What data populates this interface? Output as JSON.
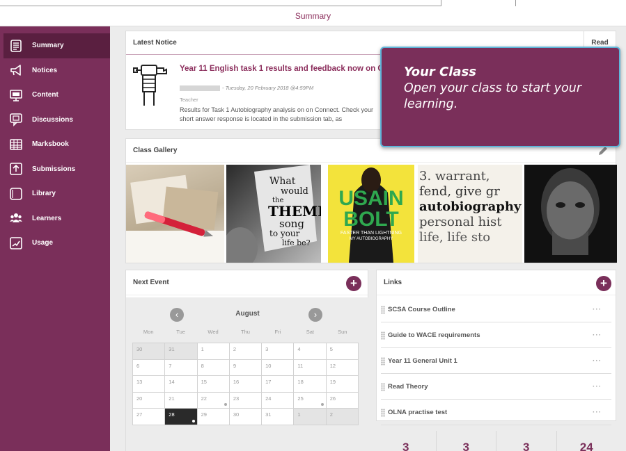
{
  "header": {
    "title": "Summary"
  },
  "sidebar": {
    "items": [
      {
        "label": "Summary",
        "icon": "summary-icon"
      },
      {
        "label": "Notices",
        "icon": "megaphone-icon"
      },
      {
        "label": "Content",
        "icon": "presentation-icon"
      },
      {
        "label": "Discussions",
        "icon": "chat-icon"
      },
      {
        "label": "Marksbook",
        "icon": "grid-icon"
      },
      {
        "label": "Submissions",
        "icon": "upload-icon"
      },
      {
        "label": "Library",
        "icon": "folder-icon"
      },
      {
        "label": "Learners",
        "icon": "people-icon"
      },
      {
        "label": "Usage",
        "icon": "chart-icon"
      }
    ]
  },
  "notice": {
    "heading": "Latest Notice",
    "read_tab": "Read",
    "title": "Year 11 English task 1 results and feedback now on C",
    "meta": "- Tuesday, 20 February 2018 @4:59PM",
    "role": "Teacher",
    "body": "Results for Task 1 Autobiography analysis on on Connect. Check your short answer response is located in the submission tab, as"
  },
  "gallery": {
    "heading": "Class Gallery",
    "tiles": [
      {
        "alt": "pen-on-photos"
      },
      {
        "alt": "What would the theme song to your life be?",
        "lines": [
          "What",
          "would",
          "the",
          "THEME",
          "song",
          "to your",
          "life be?"
        ]
      },
      {
        "alt": "Usain Bolt book cover",
        "lines": [
          "USAIN",
          "BOLT",
          "FASTER THAN LIGHTNING",
          "MY AUTOBIOGRAPHY"
        ]
      },
      {
        "alt": "dictionary autobiography",
        "lines": [
          "3.  warrant,",
          "fend, give gr",
          "autobiography",
          "personal hist",
          "life, life sto"
        ]
      },
      {
        "alt": "portrait"
      }
    ]
  },
  "events": {
    "heading": "Next Event",
    "month": "August",
    "weekdays": [
      "Mon",
      "Tue",
      "Wed",
      "Thu",
      "Fri",
      "Sat",
      "Sun"
    ],
    "weeks": [
      [
        "30",
        "31",
        "1",
        "2",
        "3",
        "4",
        "5"
      ],
      [
        "6",
        "7",
        "8",
        "9",
        "10",
        "11",
        "12"
      ],
      [
        "13",
        "14",
        "15",
        "16",
        "17",
        "18",
        "19"
      ],
      [
        "20",
        "21",
        "22",
        "23",
        "24",
        "25",
        "26"
      ],
      [
        "27",
        "28",
        "29",
        "30",
        "31",
        "1",
        "2"
      ]
    ]
  },
  "links": {
    "heading": "Links",
    "items": [
      "SCSA Course Outline",
      "Guide to WACE requirements",
      "Year 11 General Unit 1",
      "Read Theory",
      "OLNA practise test"
    ],
    "more_label": "···"
  },
  "stats": [
    "3",
    "3",
    "3",
    "24"
  ],
  "tooltip": {
    "title": "Your Class",
    "body": "Open your class to start your learning."
  },
  "colors": {
    "brand": "#7a2f5a",
    "brand_dark": "#5a1f40",
    "tooltip_border": "#5fb5d9"
  }
}
